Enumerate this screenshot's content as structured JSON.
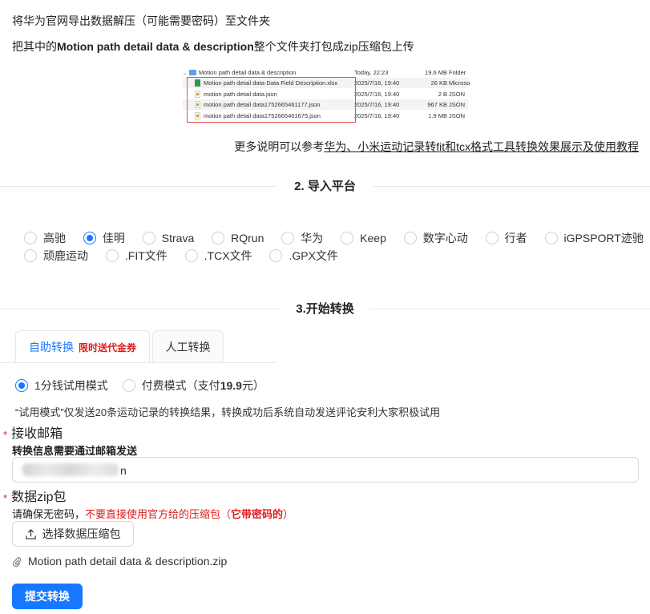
{
  "intro": {
    "line1": "将华为官网导出数据解压（可能需要密码）至文件夹",
    "line2_pre": "把其中的",
    "line2_bold": "Motion path detail data & description",
    "line2_post": "整个文件夹打包成zip压缩包上传"
  },
  "finder": {
    "rows": [
      {
        "name": "Motion path detail data & description",
        "date": "Today, 22:23",
        "size": "19.6 MB",
        "kind": "Folder",
        "icon": "folder-icon"
      },
      {
        "name": "Motion path detail data-Data Field Description.xlsx",
        "date": "2025/7/16, 19:40",
        "size": "26 KB",
        "kind": "Microso",
        "icon": "excel-file-icon"
      },
      {
        "name": "motion path detail data.json",
        "date": "2025/7/16, 19:40",
        "size": "2 B",
        "kind": "JSON",
        "icon": "json-file-icon"
      },
      {
        "name": "motion path detail data1752665461177.json",
        "date": "2025/7/16, 19:40",
        "size": "967 KB",
        "kind": "JSON",
        "icon": "json-file-icon"
      },
      {
        "name": "motion path detail data1752665461675.json",
        "date": "2025/7/16, 19:40",
        "size": "1.9 MB",
        "kind": "JSON",
        "icon": "json-file-icon"
      }
    ]
  },
  "more": {
    "prefix": "更多说明可以参考",
    "link": "华为、小米运动记录转fit和tcx格式工具转换效果展示及使用教程"
  },
  "section2": {
    "title": "2. 导入平台"
  },
  "platforms": {
    "row1": [
      "高驰",
      "佳明",
      "Strava",
      "RQrun",
      "华为",
      "Keep",
      "数字心动",
      "行者",
      "iGPSPORT迹驰"
    ],
    "row2": [
      "顽鹿运动",
      ".FIT文件",
      ".TCX文件",
      ".GPX文件"
    ],
    "selected": "佳明"
  },
  "section3": {
    "title": "3.开始转换"
  },
  "tabs": {
    "auto": "自助转换",
    "auto_promo": "限时送代金券",
    "manual": "人工转换"
  },
  "mode": {
    "trial": "1分钱试用模式",
    "paid_pre": "付费模式（支付",
    "paid_price": "19.9",
    "paid_post": "元）",
    "note": "“试用模式”仅发送20条运动记录的转换结果，转换成功后系统自动发送评论安利大家积极试用"
  },
  "email": {
    "label": "接收邮箱",
    "hint": "转换信息需要通过邮箱发送",
    "value_suffix": "n"
  },
  "zip": {
    "label": "数据zip包",
    "warn_pre": "请确保无密码，",
    "warn_red": "不要直接使用官方给的压缩包（",
    "warn_bold": "它带密码的",
    "warn_end": "）",
    "upload_button": "选择数据压缩包",
    "file_name": "Motion path detail data & description.zip"
  },
  "submit": {
    "label": "提交转换"
  },
  "colors": {
    "primary": "#1677ff",
    "danger": "#e01b1b"
  }
}
